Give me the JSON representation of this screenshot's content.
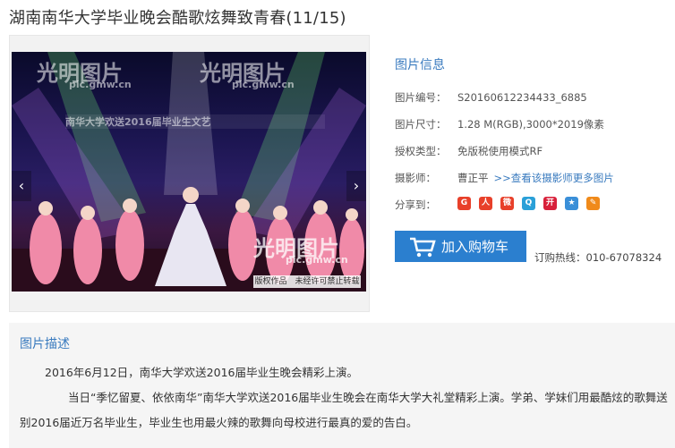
{
  "page": {
    "title": "湖南南华大学毕业晚会酷歌炫舞致青春(11/15)"
  },
  "photo": {
    "watermark_brand": "光明图片",
    "watermark_url": "pic.gmw.cn",
    "banner_text": "南华大学欢送2016届毕业生文艺",
    "copyright": "版权作品　未经许可禁止转载",
    "prev_label": "‹",
    "next_label": "›"
  },
  "info": {
    "section_title": "图片信息",
    "id_label": "图片编号：",
    "id_value": "S20160612234433_6885",
    "size_label": "图片尺寸：",
    "size_value": "1.28 M(RGB),3000*2019像素",
    "license_label": "授权类型：",
    "license_value": "免版税使用模式RF",
    "photographer_label": "摄影师：",
    "photographer_value": "曹正平",
    "photographer_more": ">>查看该摄影师更多图片",
    "share_label": "分享到："
  },
  "share_icons": [
    "share-icon-g",
    "share-icon-renren",
    "share-icon-weibo",
    "share-icon-qzone",
    "share-icon-kaixin",
    "share-icon-star",
    "share-icon-edit"
  ],
  "cart": {
    "label": "加入购物车"
  },
  "hotline": {
    "text": "订购热线：010-67078324"
  },
  "description": {
    "title": "图片描述",
    "p1": "2016年6月12日，南华大学欢送2016届毕业生晚会精彩上演。",
    "p2": "当日“季忆留夏、依依南华”南华大学欢送2016届毕业生晚会在南华大学大礼堂精彩上演。学弟、学妹们用最酷炫的歌舞送别2016届近万名毕业生，毕业生也用最火辣的歌舞向母校进行最真的爱的告白。"
  },
  "colors": {
    "accent": "#3a7bbf",
    "cart": "#2b7fcf"
  }
}
